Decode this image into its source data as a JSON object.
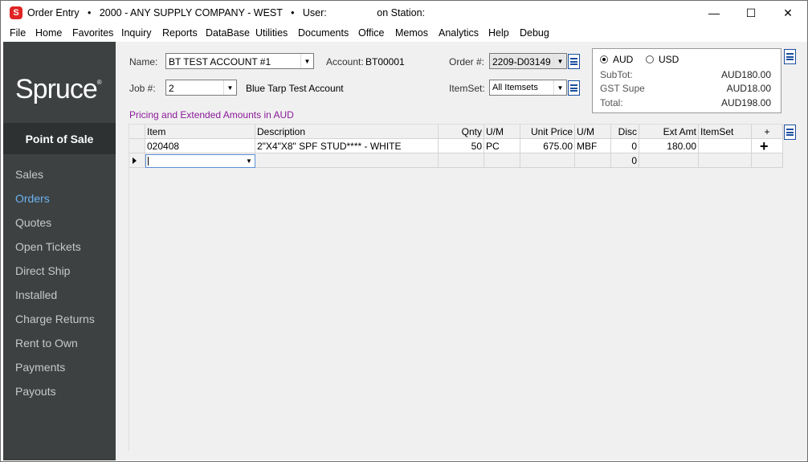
{
  "window": {
    "title": "Order Entry   •   2000 - ANY SUPPLY COMPANY - WEST   •   User:                  on Station:",
    "app_icon": "S",
    "controls": {
      "minimize": "—",
      "maximize": "☐",
      "close": "✕"
    }
  },
  "menu": [
    "File",
    "Home",
    "Favorites",
    "Inquiry",
    "Reports",
    "DataBase",
    "Utilities",
    "Documents",
    "Office",
    "Memos",
    "Analytics",
    "Help",
    "Debug"
  ],
  "sidebar": {
    "logo": "Spruce",
    "logo_mark": "®",
    "section": "Point of Sale",
    "items": [
      {
        "label": "Sales",
        "active": false
      },
      {
        "label": "Orders",
        "active": true
      },
      {
        "label": "Quotes",
        "active": false
      },
      {
        "label": "Open Tickets",
        "active": false
      },
      {
        "label": "Direct Ship",
        "active": false
      },
      {
        "label": "Installed",
        "active": false
      },
      {
        "label": "Charge Returns",
        "active": false
      },
      {
        "label": "Rent to Own",
        "active": false
      },
      {
        "label": "Payments",
        "active": false
      },
      {
        "label": "Payouts",
        "active": false
      }
    ]
  },
  "form": {
    "name_label": "Name:",
    "name_value": "BT TEST ACCOUNT #1",
    "account_label": "Account:",
    "account_value": "BT00001",
    "order_label": "Order #:",
    "order_value": "2209-D03149",
    "job_label": "Job #:",
    "job_value": "2",
    "job_desc": "Blue Tarp Test Account",
    "itemset_label": "ItemSet:",
    "itemset_value": "All Itemsets"
  },
  "totals": {
    "currency_1": "AUD",
    "currency_2": "USD",
    "selected": "AUD",
    "subtot_label": "SubTot:",
    "subtot_value": "AUD180.00",
    "gst_label": "GST Supe",
    "gst_value": "AUD18.00",
    "total_label": "Total:",
    "total_value": "AUD198.00"
  },
  "pricing_note": "Pricing and Extended Amounts in AUD",
  "grid": {
    "headers": [
      "Item",
      "Description",
      "Qnty",
      "U/M",
      "Unit Price",
      "U/M",
      "Disc",
      "Ext Amt",
      "ItemSet",
      "+"
    ],
    "rows": [
      [
        "020408",
        "2\"X4\"X8\" SPF STUD**** - WHITE",
        "50",
        "PC",
        "675.00",
        "MBF",
        "0",
        "180.00",
        "",
        "+"
      ],
      [
        "",
        "",
        "",
        "",
        "",
        "",
        "0",
        "",
        "",
        ""
      ]
    ]
  },
  "colors": {
    "sidebar_bg": "#3d4142",
    "active_nav": "#6cb4f0",
    "note_purple": "#8b1a9a",
    "brand_red": "#e02424"
  }
}
